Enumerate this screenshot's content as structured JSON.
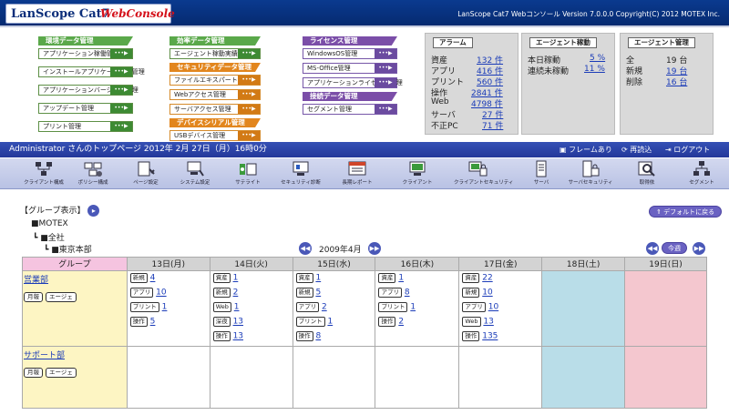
{
  "header": {
    "logo_main": "LanScope Cat7",
    "logo_sub": "WebConsole",
    "version": "LanScope Cat7 Webコンソール  Version 7.0.0.0 Copyright(C) 2012 MOTEX Inc."
  },
  "menu": {
    "col1": {
      "category": "環境データ管理",
      "items": [
        "アプリケーション稼働管理",
        "インストールアプリケーション管理",
        "アプリケーションバージョン管理",
        "アップデート管理",
        "プリント管理"
      ]
    },
    "col2": {
      "categories": [
        {
          "label": "効率データ管理",
          "items": [
            "エージェント稼動実績"
          ]
        },
        {
          "label": "セキュリティデータ管理",
          "items": [
            "ファイルエキスパート管理",
            "Webアクセス管理",
            "サーバアクセス管理"
          ]
        },
        {
          "label": "デバイスシリアル管理",
          "items": [
            "USBデバイス管理"
          ]
        }
      ]
    },
    "col3": {
      "categories": [
        {
          "label": "ライセンス管理",
          "items": [
            "WindowsOS管理",
            "MS-Office管理",
            "アプリケーションライセンス管理"
          ]
        },
        {
          "label": "接続データ管理",
          "items": [
            "セグメント管理"
          ]
        }
      ]
    },
    "arrow_label": "•••▶"
  },
  "alarm": {
    "title": "アラーム",
    "rows": [
      {
        "label": "資産",
        "value": "132 件"
      },
      {
        "label": "アプリ",
        "value": "416 件"
      },
      {
        "label": "プリント",
        "value": "560 件"
      },
      {
        "label": "操作",
        "value": "2841 件"
      },
      {
        "label": "Web",
        "value": "4798 件"
      },
      {
        "label": "サーバ",
        "value": "27 件"
      },
      {
        "label": "不正PC",
        "value": "71 件"
      }
    ]
  },
  "agent_run": {
    "title": "エージェント稼動",
    "rows": [
      {
        "label": "本日稼動",
        "value": "5 %"
      },
      {
        "label": "連続未稼動",
        "value": "11 %"
      }
    ]
  },
  "agent_mgmt": {
    "title": "エージェント管理",
    "rows": [
      {
        "label": "全",
        "value": "19 台",
        "link": false
      },
      {
        "label": "新規",
        "value": "19 台",
        "link": true
      },
      {
        "label": "削除",
        "value": "16 台",
        "link": true
      }
    ]
  },
  "infobar": {
    "user_text": "Administrator さんのトップページ  2012年 2月 27日（月）16時0分",
    "frame": "フレームあり",
    "reload": "再読込",
    "logout": "ログアウト"
  },
  "toolbar": [
    {
      "id": "client-config",
      "label": "クライアント構成",
      "icon": "client-config-icon"
    },
    {
      "id": "policy-config",
      "label": "ポリシー構成",
      "icon": "policy-config-icon"
    },
    {
      "id": "page-settings",
      "label": "ページ設定",
      "icon": "page-settings-icon"
    },
    {
      "id": "system-settings",
      "label": "システム設定",
      "icon": "system-settings-icon"
    },
    {
      "id": "satellite",
      "label": "サテライト",
      "icon": "satellite-icon"
    },
    {
      "id": "security-diagnosis",
      "label": "セキュリティ診断",
      "icon": "security-diagnosis-icon"
    },
    {
      "id": "long-report",
      "label": "長期レポート",
      "icon": "long-report-icon"
    },
    {
      "id": "client",
      "label": "クライアント",
      "icon": "client-icon"
    },
    {
      "id": "client-security",
      "label": "クライアントセキュリティ",
      "icon": "client-security-icon"
    },
    {
      "id": "server",
      "label": "サーバ",
      "icon": "server-icon"
    },
    {
      "id": "server-security",
      "label": "サーバセキュリティ",
      "icon": "server-security-icon"
    },
    {
      "id": "search",
      "label": "取得依",
      "icon": "search-icon"
    },
    {
      "id": "segment",
      "label": "セグメント",
      "icon": "segment-icon"
    }
  ],
  "calendar": {
    "group_display": "【グループ表示】",
    "default_btn": "デフォルトに戻る",
    "tree": [
      "MOTEX",
      "全社",
      "東京本部"
    ],
    "month": "2009年4月",
    "today": "今週",
    "group_header": "グループ",
    "days": [
      "13日(月)",
      "14日(火)",
      "15日(水)",
      "16日(木)",
      "17日(金)",
      "18日(土)",
      "19日(日)"
    ],
    "groups": [
      {
        "name": "営業部",
        "btns": [
          "月報",
          "エージェ"
        ],
        "days": [
          [
            {
              "tag": "新規",
              "val": "4"
            },
            {
              "tag": "アプリ",
              "val": "10"
            },
            {
              "tag": "プリント",
              "val": "1"
            },
            {
              "tag": "操作",
              "val": "5"
            }
          ],
          [
            {
              "tag": "資産",
              "val": "1"
            },
            {
              "tag": "新規",
              "val": "2"
            },
            {
              "tag": "Web",
              "val": "1"
            },
            {
              "tag": "深夜",
              "val": "13"
            },
            {
              "tag": "操作",
              "val": "13"
            }
          ],
          [
            {
              "tag": "資産",
              "val": "1"
            },
            {
              "tag": "新規",
              "val": "5"
            },
            {
              "tag": "アプリ",
              "val": "2"
            },
            {
              "tag": "プリント",
              "val": "1"
            },
            {
              "tag": "操作",
              "val": "8"
            }
          ],
          [
            {
              "tag": "資産",
              "val": "1"
            },
            {
              "tag": "アプリ",
              "val": "8"
            },
            {
              "tag": "プリント",
              "val": "1"
            },
            {
              "tag": "操作",
              "val": "2"
            }
          ],
          [
            {
              "tag": "資産",
              "val": "22"
            },
            {
              "tag": "新規",
              "val": "10"
            },
            {
              "tag": "アプリ",
              "val": "10"
            },
            {
              "tag": "Web",
              "val": "13"
            },
            {
              "tag": "操作",
              "val": "135"
            }
          ],
          [],
          []
        ]
      },
      {
        "name": "サポート部",
        "btns": [
          "月報",
          "エージェ"
        ],
        "days": [
          [],
          [],
          [],
          [],
          [],
          [],
          []
        ]
      }
    ]
  }
}
